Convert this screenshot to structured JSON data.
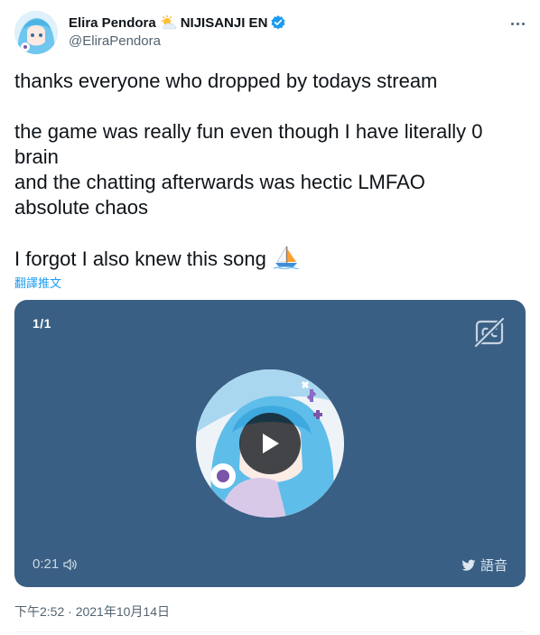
{
  "author": {
    "display_name": "Elira Pendora",
    "affiliation": "NIJISANJI EN",
    "handle": "@EliraPendora",
    "verified": true,
    "name_emoji": "sun-behind-cloud-icon"
  },
  "tweet": {
    "text": "thanks everyone who dropped by todays stream\n\nthe game was really fun even though I have literally 0 brain\nand the chatting afterwards was hectic LMFAO\nabsolute chaos\n\nI forgot I also knew this song ",
    "emoji": "sailboat-icon",
    "translate_label": "翻譯推文",
    "timestamp": "下午2:52 · 2021年10月14日"
  },
  "media": {
    "counter": "1/1",
    "elapsed": "0:21",
    "voice_label": "語音",
    "background_color": "#3a5f84",
    "icons": [
      "closed-captions-off-icon",
      "play-icon",
      "volume-icon",
      "twitter-bird-icon"
    ]
  },
  "colors": {
    "text": "#0f1419",
    "secondary": "#536471",
    "link": "#1d9bf0",
    "verified": "#1d9bf0"
  }
}
